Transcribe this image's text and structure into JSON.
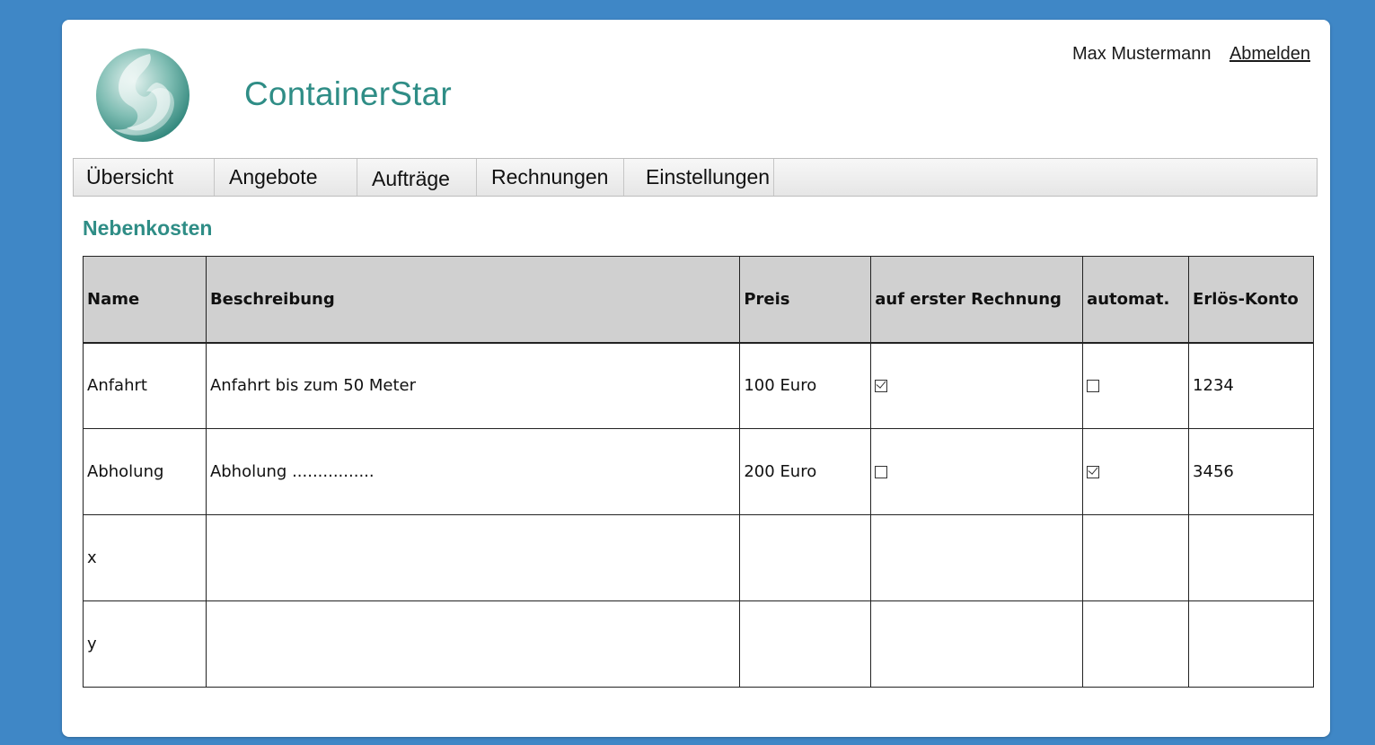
{
  "header": {
    "app_title": "ContainerStar",
    "user_name": "Max Mustermann",
    "logout_label": "Abmelden"
  },
  "nav": {
    "tabs": [
      {
        "label": "Übersicht"
      },
      {
        "label": "Angebote"
      },
      {
        "label": "Aufträge"
      },
      {
        "label": "Rechnungen"
      },
      {
        "label": "Einstellungen"
      }
    ]
  },
  "section": {
    "title": "Nebenkosten"
  },
  "table": {
    "columns": [
      "Name",
      "Beschreibung",
      "Preis",
      "auf erster Rechnung",
      "automat.",
      "Erlös-Konto"
    ],
    "rows": [
      {
        "name": "Anfahrt",
        "description": "Anfahrt bis zum 50 Meter",
        "price": "100 Euro",
        "first_invoice": true,
        "automatic": false,
        "account": "1234"
      },
      {
        "name": "Abholung",
        "description": "Abholung ................",
        "price": "200 Euro",
        "first_invoice": false,
        "automatic": true,
        "account": "3456"
      },
      {
        "name": "x",
        "description": "",
        "price": "",
        "first_invoice": null,
        "automatic": null,
        "account": ""
      },
      {
        "name": "y",
        "description": "",
        "price": "",
        "first_invoice": null,
        "automatic": null,
        "account": ""
      }
    ]
  },
  "colors": {
    "background": "#3f87c6",
    "accent": "#2f8d86",
    "header_row": "#d0d0d0"
  }
}
